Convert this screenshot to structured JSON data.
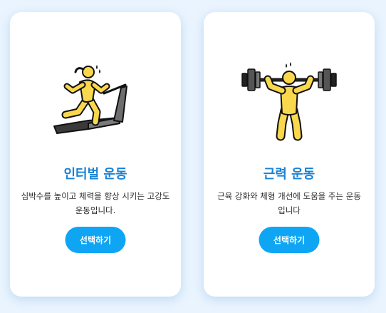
{
  "colors": {
    "page_background": "#e9f4fe",
    "card_background": "#ffffff",
    "title": "#1a82d4",
    "button": "#0ea6f4",
    "figure_yellow": "#f9d84e",
    "machine_gray": "#6e6e6e"
  },
  "cards": [
    {
      "icon": "treadmill-runner-icon",
      "title": "인터벌 운동",
      "description": "심박수를 높이고 체력을 향상 시키는 고강도 운동입니다.",
      "button_label": "선택하기"
    },
    {
      "icon": "weightlifter-icon",
      "title": "근력 운동",
      "description": "근육 강화와 체형 개선에 도움을 주는 운동입니다",
      "button_label": "선택하기"
    }
  ]
}
